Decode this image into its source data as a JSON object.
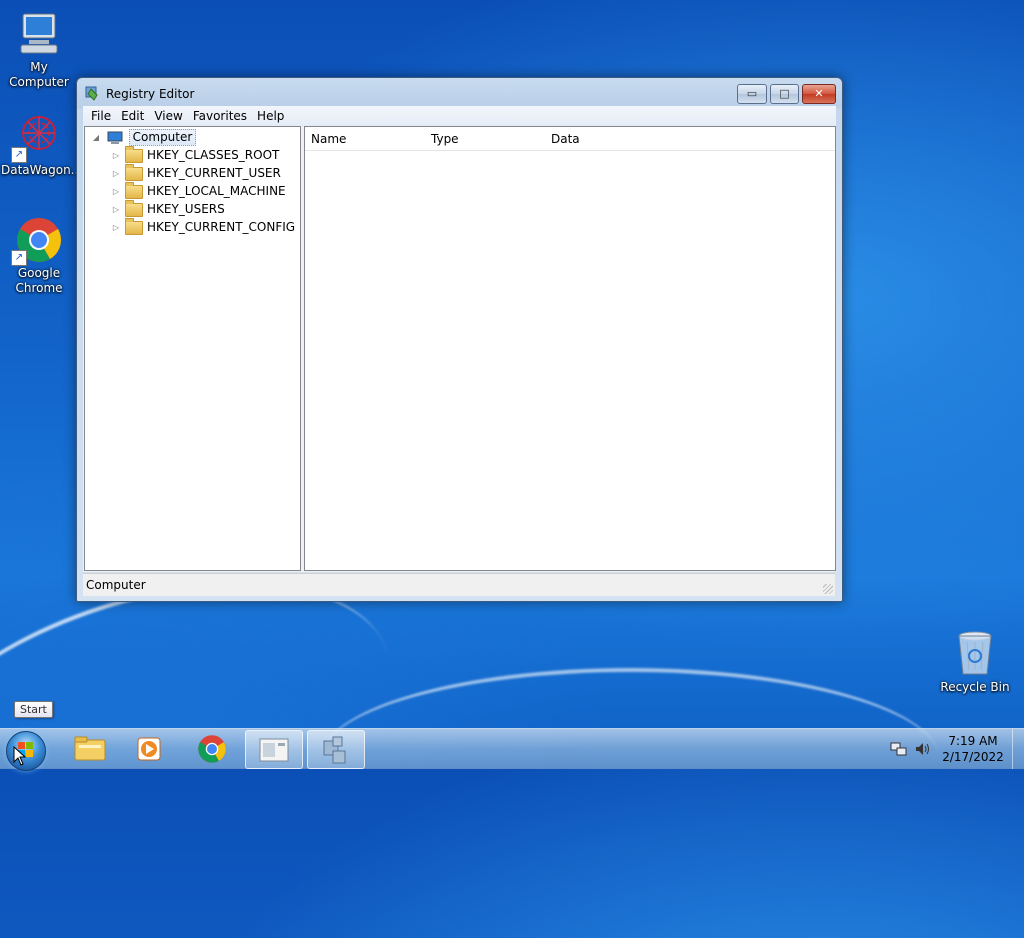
{
  "desktop": {
    "icons": [
      {
        "label": "My Computer"
      },
      {
        "label": "DataWagon..."
      },
      {
        "label": "Google Chrome"
      },
      {
        "label": "Recycle Bin"
      }
    ]
  },
  "window": {
    "title": "Registry Editor",
    "controls": {
      "minimize": "▭",
      "maximize": "□",
      "close": "✕"
    },
    "menu": [
      "File",
      "Edit",
      "View",
      "Favorites",
      "Help"
    ],
    "tree": {
      "root": "Computer",
      "children": [
        "HKEY_CLASSES_ROOT",
        "HKEY_CURRENT_USER",
        "HKEY_LOCAL_MACHINE",
        "HKEY_USERS",
        "HKEY_CURRENT_CONFIG"
      ]
    },
    "columns": [
      "Name",
      "Type",
      "Data"
    ],
    "status": "Computer"
  },
  "taskbar": {
    "tooltip": "Start",
    "clock": {
      "time": "7:19 AM",
      "date": "2/17/2022"
    }
  }
}
